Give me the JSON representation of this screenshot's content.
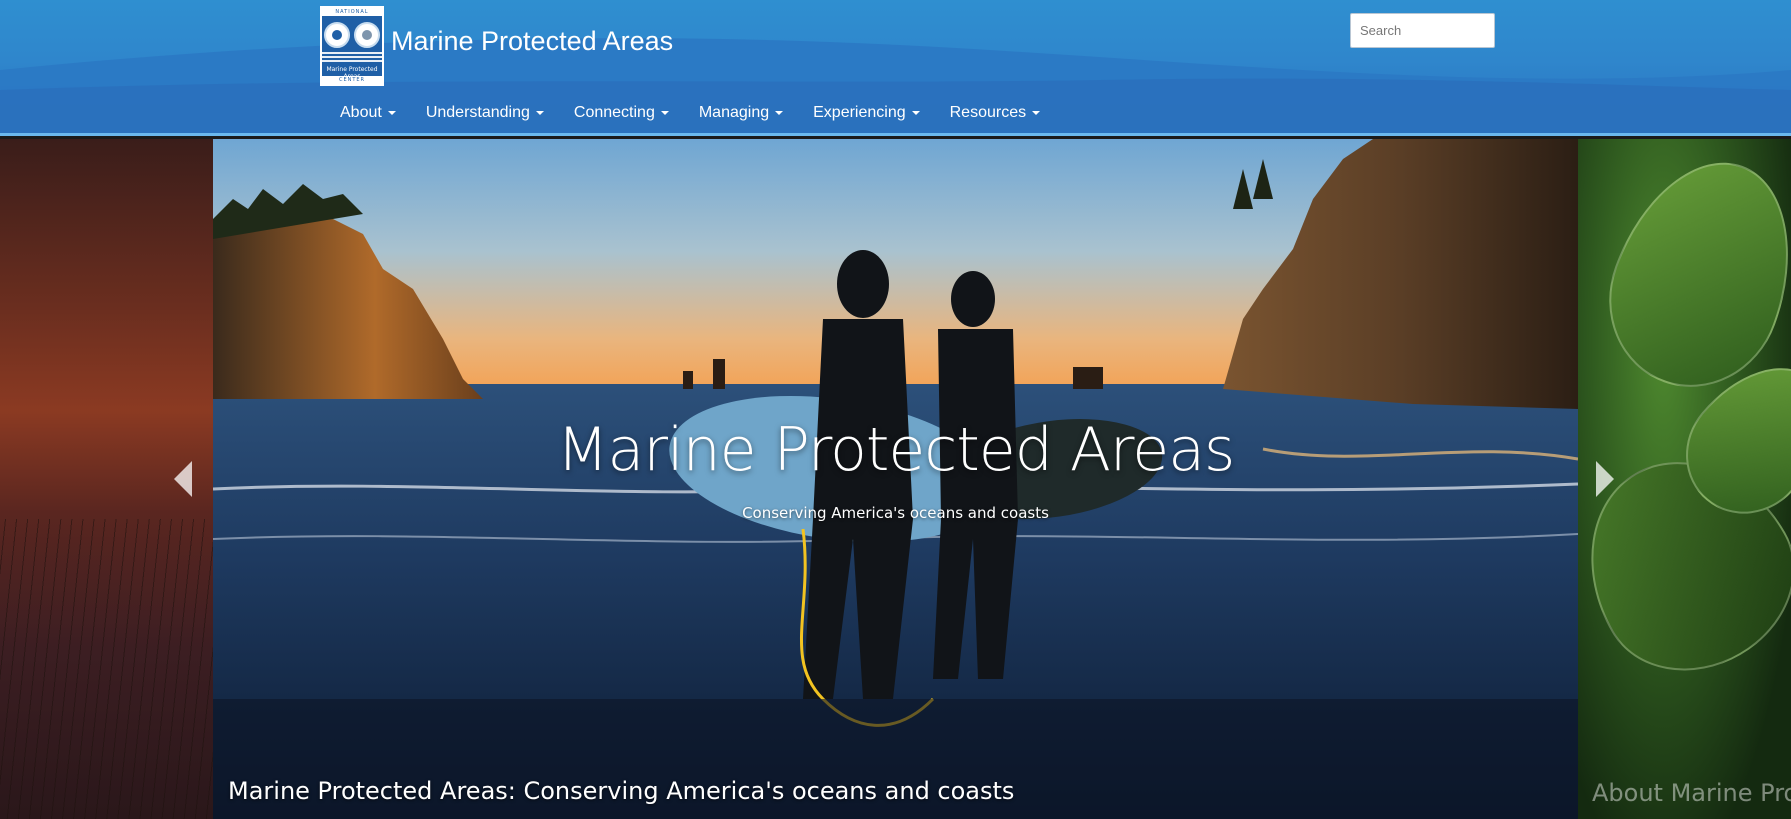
{
  "header": {
    "logo": {
      "top_text": "NATIONAL",
      "middle_text": "Marine Protected Areas",
      "bottom_text": "CENTER"
    },
    "site_title": "Marine Protected Areas",
    "search": {
      "placeholder": "Search",
      "value": ""
    },
    "nav": [
      {
        "label": "About"
      },
      {
        "label": "Understanding"
      },
      {
        "label": "Connecting"
      },
      {
        "label": "Managing"
      },
      {
        "label": "Experiencing"
      },
      {
        "label": "Resources"
      }
    ]
  },
  "carousel": {
    "active_slide": {
      "title": "Marine Protected Areas",
      "subtitle": "Conserving America's oceans and coasts",
      "caption": "Marine Protected Areas: Conserving America's oceans and coasts"
    },
    "next_slide_caption": "About Marine Pro",
    "icons": {
      "prev": "chevron-left-icon",
      "next": "chevron-right-icon"
    }
  },
  "colors": {
    "header_blue": "#2f86cc",
    "header_rule": "#6ab8ee",
    "text_white": "#ffffff"
  }
}
